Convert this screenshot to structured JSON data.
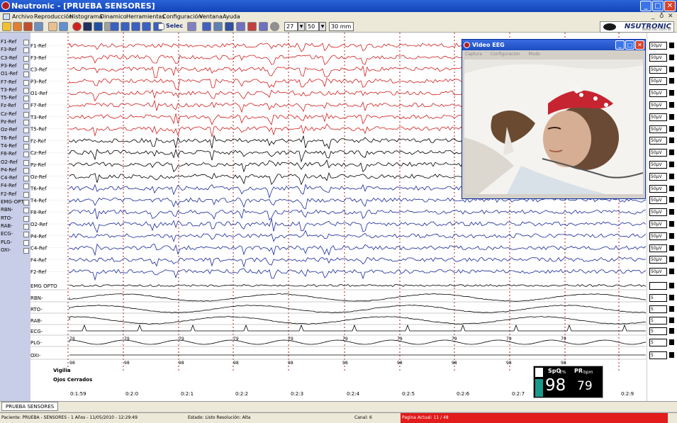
{
  "window": {
    "title": "Neutronic - [PRUEBA SENSORES]"
  },
  "menu": [
    "Archivo",
    "Reproducción",
    "Histograma",
    "Dinamico",
    "Herramientas",
    "Configuración",
    "Ventana",
    "Ayuda"
  ],
  "mdi_controls": [
    "_",
    "♁",
    "✕"
  ],
  "toolbar": {
    "select_label": "Selec",
    "value1": "27",
    "value2": "50",
    "value3": "30 mm"
  },
  "logo": {
    "text": "NSUTRONIC",
    "subtext": "www.nsc.com.ar"
  },
  "channels": [
    "F1-Ref",
    "F3-Ref",
    "C3-Ref",
    "P3-Ref",
    "O1-Ref",
    "F7-Ref",
    "T3-Ref",
    "T5-Ref",
    "Fz-Ref",
    "Cz-Ref",
    "Pz-Ref",
    "Oz-Ref",
    "T6-Ref",
    "T4-Ref",
    "F8-Ref",
    "O2-Ref",
    "P4-Ref",
    "C4-Ref",
    "F4-Ref",
    "F2-Ref",
    "EMG-OPT",
    "RBN-",
    "RTO-",
    "RAB-",
    "ECG-",
    "PLG-",
    "OXI-"
  ],
  "traces": {
    "red": {
      "color": "#d42020",
      "labels": [
        "F1-Ref",
        "F3-Ref",
        "C3-Ref",
        "P3-Ref",
        "O1-Ref",
        "F7-Ref",
        "T3-Ref",
        "T5-Ref"
      ]
    },
    "black": {
      "color": "#000000",
      "labels": [
        "Fz-Ref",
        "Cz-Ref",
        "Pz-Ref",
        "Oz-Ref"
      ]
    },
    "blue": {
      "color": "#1a2a9a",
      "labels": [
        "T6-Ref",
        "T4-Ref",
        "F8-Ref",
        "O2-Ref",
        "P4-Ref",
        "C4-Ref",
        "F4-Ref",
        "F2-Ref"
      ]
    },
    "poly": {
      "color": "#000000",
      "labels": [
        "EMG OPTO",
        "RBN-",
        "RTO-",
        "RAB-",
        "ECG-",
        "PLG-",
        "OXI-"
      ]
    }
  },
  "right_scale": {
    "eeg": "50µV",
    "poly": [
      "",
      "5",
      "5",
      "5",
      "5",
      "5",
      "5"
    ]
  },
  "pulse_values": [
    "79",
    "79",
    "79",
    "79",
    "79",
    "79",
    "79",
    "79",
    "79",
    "79"
  ],
  "oxi_values": [
    "98",
    "98",
    "98",
    "98",
    "98",
    "98",
    "98",
    "98",
    "98",
    "98"
  ],
  "annotations": [
    "Vigilia",
    "Ojos Cerrados"
  ],
  "time_labels": [
    "0:1:59",
    "0:2:0",
    "0:2:1",
    "0:2:2",
    "0:2:3",
    "0:2:4",
    "0:2:5",
    "0:2:6",
    "0:2:7",
    "0:2:8",
    "0:2:9"
  ],
  "video": {
    "title": "Video EEG",
    "menu": [
      "Captura",
      "Configuracion",
      "Modo"
    ]
  },
  "spo2": {
    "spo2_label": "SpO",
    "spo2_sub": "2%",
    "pr_label": "PR",
    "pr_sub": "bpm",
    "spo2_value": "98",
    "pr_value": "79"
  },
  "tabs": [
    "PRUEBA SENSORES"
  ],
  "status": {
    "patient": "Paciente: PRUEBA - SENSORES - 1 Años - 11/05/2010 - 12:29:49",
    "state": "Estado: Listo  Resolución: Alta",
    "channel": "Canal: 6",
    "page": "Pagina Actual: 11 / 48"
  }
}
